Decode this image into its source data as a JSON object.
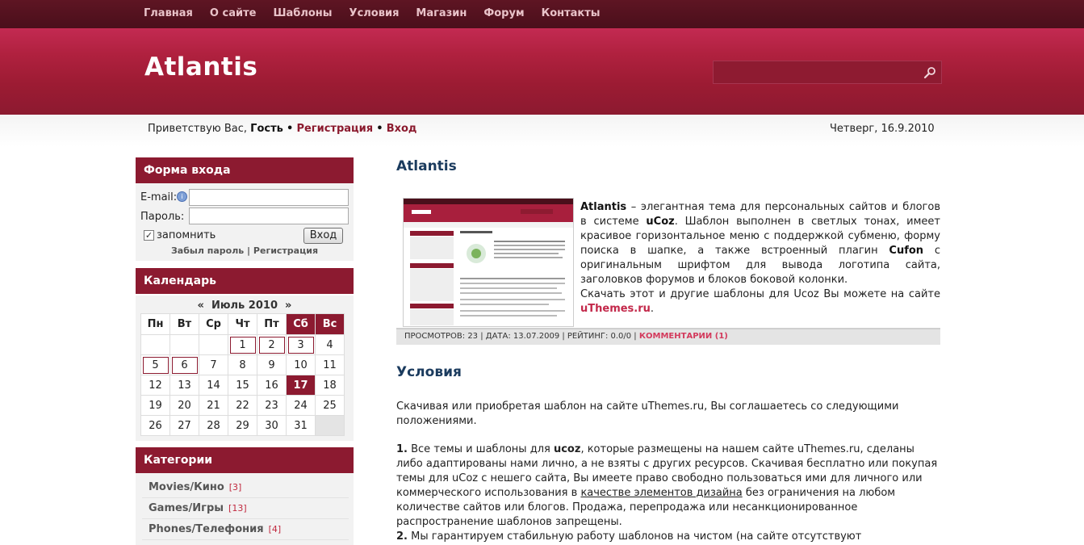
{
  "nav": [
    "Главная",
    "О сайте",
    "Шаблоны",
    "Условия",
    "Магазин",
    "Форум",
    "Контакты"
  ],
  "site_title": "Atlantis",
  "search": {
    "placeholder": ""
  },
  "userbar": {
    "greeting": "Приветствую Вас,",
    "guest": "Гость",
    "sep": "•",
    "register": "Регистрация",
    "login": "Вход",
    "date": "Четверг, 16.9.2010"
  },
  "login_form": {
    "title": "Форма входа",
    "email_label": "E-mail:",
    "password_label": "Пароль:",
    "remember": "запомнить",
    "submit": "Вход",
    "forgot": "Забыл пароль",
    "divider": "|",
    "register": "Регистрация"
  },
  "calendar": {
    "title": "Календарь",
    "prev": "«",
    "month": "Июль 2010",
    "next": "»",
    "weekdays": [
      "Пн",
      "Вт",
      "Ср",
      "Чт",
      "Пт",
      "Сб",
      "Вс"
    ],
    "rows": [
      [
        "",
        "",
        "",
        "1",
        "2",
        "3",
        "4"
      ],
      [
        "5",
        "6",
        "7",
        "8",
        "9",
        "10",
        "11"
      ],
      [
        "12",
        "13",
        "14",
        "15",
        "16",
        "17",
        "18"
      ],
      [
        "19",
        "20",
        "21",
        "22",
        "23",
        "24",
        "25"
      ],
      [
        "26",
        "27",
        "28",
        "29",
        "30",
        "31",
        ""
      ]
    ],
    "today": "17"
  },
  "categories": {
    "title": "Категории",
    "items": [
      {
        "name": "Movies/Кино",
        "count": "[3]"
      },
      {
        "name": "Games/Игры",
        "count": "[13]"
      },
      {
        "name": "Phones/Телефония",
        "count": "[4]"
      }
    ]
  },
  "entry": {
    "title": "Atlantis",
    "t1": "Atlantis",
    "t2": " – элегантная тема для персональных сайтов и блогов в системе ",
    "t3": "uCoz",
    "t4": ". Шаблон выполнен в светлых тонах, имеет красивое горизонтальное меню с поддержкой субменю, форму поиска в шапке, а также встроенный плагин ",
    "t5": "Cufon",
    "t6": " с оригинальным шрифтом для вывода логотипа сайта, заголовков форумов и блоков боковой колонки.",
    "t7": "Скачать этот и другие шаблоны для Ucoz Вы можете на сайте ",
    "t8": "uThemes.ru",
    "t9": ".",
    "meta": "ПРОСМОТРОВ: 23 | ДАТА: 13.07.2009 | РЕЙТИНГ: 0.0/0 | ",
    "comments": "КОММЕНТАРИИ (1)"
  },
  "terms": {
    "title": "Условия",
    "intro": "Скачивая или приобретая шаблон на сайте uThemes.ru, Вы соглашаетесь со следующими положениями.",
    "p1_num": "1.",
    "p1_a": " Все темы и шаблоны для ",
    "p1_b": "ucoz",
    "p1_c": ", которые размещены на нашем сайте uThemes.ru, сделаны либо адаптированы нами лично, а не взяты с других ресурсов. Скачивая бесплатно или покупая темы для uCoz с нешего сайта, Вы имеете право свободно пользоваться ими для личного или коммерческого использования в ",
    "p1_link": "качестве элементов дизайна",
    "p1_d": " без ограничения на любом количестве сайтов или блогов. Продажа, перепродажа или несанкционированное распространение шаблонов запрещены.",
    "p2_num": "2.",
    "p2_a": " Мы гарантируем стабильную работу шаблонов на чистом (на сайте отсутствуют пользовательские"
  }
}
